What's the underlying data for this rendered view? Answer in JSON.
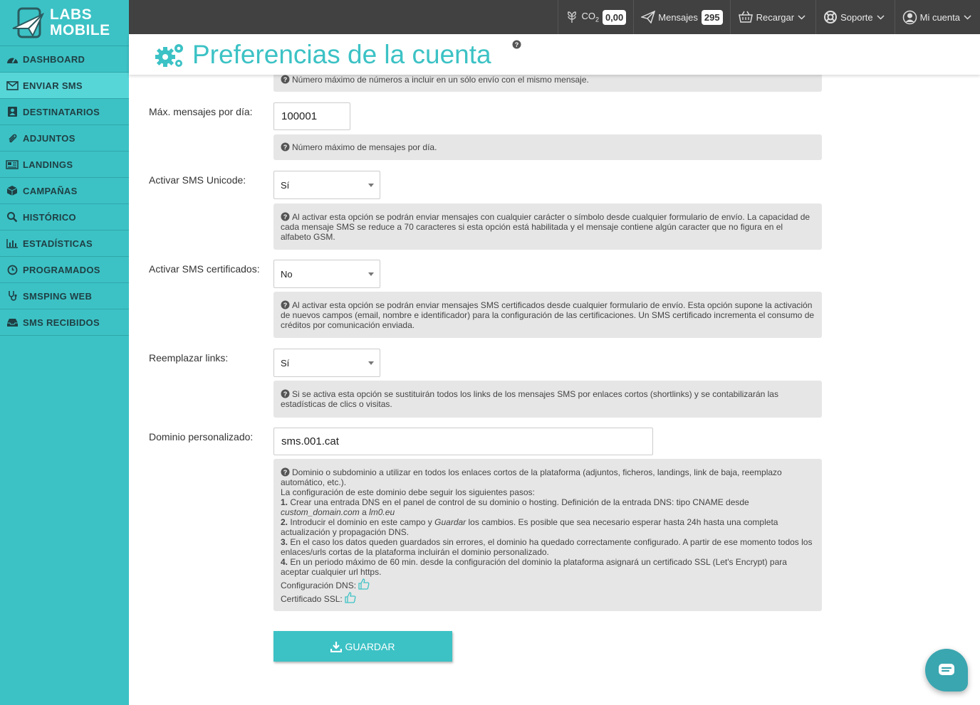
{
  "brand": {
    "line1": "LABS",
    "line2": "MOBILE"
  },
  "sidebar": {
    "items": [
      {
        "label": "DASHBOARD",
        "icon": "dashboard-icon"
      },
      {
        "label": "ENVIAR SMS",
        "icon": "envelope-icon",
        "active": true
      },
      {
        "label": "DESTINATARIOS",
        "icon": "contacts-icon"
      },
      {
        "label": "ADJUNTOS",
        "icon": "paperclip-icon"
      },
      {
        "label": "LANDINGS",
        "icon": "newspaper-icon"
      },
      {
        "label": "CAMPAÑAS",
        "icon": "cube-icon"
      },
      {
        "label": "HISTÓRICO",
        "icon": "search-icon"
      },
      {
        "label": "ESTADÍSTICAS",
        "icon": "bar-chart-icon"
      },
      {
        "label": "PROGRAMADOS",
        "icon": "clock-icon"
      },
      {
        "label": "SMSPING WEB",
        "icon": "stethoscope-icon"
      },
      {
        "label": "SMS RECIBIDOS",
        "icon": "inbox-icon"
      }
    ]
  },
  "topbar": {
    "co2_label": "CO",
    "co2_sub": "2",
    "co2_value": "0,00",
    "messages_label": "Mensajes",
    "messages_value": "295",
    "recharge_label": "Recargar",
    "support_label": "Soporte",
    "account_label": "Mi cuenta"
  },
  "page": {
    "title": "Preferencias de la cuenta"
  },
  "form": {
    "top_help": "Número máximo de números a incluir en un sólo envío con el mismo mensaje.",
    "max_per_day": {
      "label": "Máx. mensajes por día:",
      "value": "100001",
      "help": "Número máximo de mensajes por día."
    },
    "unicode": {
      "label": "Activar SMS Unicode:",
      "value": "Sí",
      "help": "Al activar esta opción se podrán enviar mensajes con cualquier carácter o símbolo desde cualquier formulario de envío. La capacidad de cada mensaje SMS se reduce a 70 caracteres si esta opción está habilitada y el mensaje contiene algún caracter que no figura en el alfabeto GSM."
    },
    "certified": {
      "label": "Activar SMS certificados:",
      "value": "No",
      "help": "Al activar esta opción se podrán enviar mensajes SMS certificados desde cualquier formulario de envío. Esta opción supone la activación de nuevos campos (email, nombre e identificador) para la configuración de las certificaciones. Un SMS certificado incrementa el consumo de créditos por comunicación enviada."
    },
    "links": {
      "label": "Reemplazar links:",
      "value": "Sí",
      "help": "Si se activa esta opción se sustituirán todos los links de los mensajes SMS por enlaces cortos (shortlinks) y se contabilizarán las estadísticas de clics o visitas."
    },
    "domain": {
      "label": "Dominio personalizado:",
      "value": "sms.001.cat",
      "help_intro": "Dominio o subdominio a utilizar en todos los enlaces cortos de la plataforma (adjuntos, ficheros, landings, link de baja, reemplazo automático, etc.).",
      "help_steps_title": "La configuración de este dominio debe seguir los siguientes pasos:",
      "step1_num": "1.",
      "step1_text": "Crear una entrada DNS en el panel de control de su dominio o hosting. Definición de la entrada DNS: tipo CNAME desde",
      "step1_from": "custom_domain.com",
      "step1_a": "a",
      "step1_to": "lm0.eu",
      "step2_num": "2.",
      "step2_a": "Introducir el dominio en este campo y",
      "step2_em": "Guardar",
      "step2_b": "los cambios. Es posible que sea necesario esperar hasta 24h hasta una completa actualización y propagación DNS.",
      "step3_num": "3.",
      "step3_text": "En el caso los datos queden guardados sin errores, el dominio ha quedado correctamente configurado. A partir de ese momento todos los enlaces/urls cortas de la plataforma incluirán el dominio personalizado.",
      "step4_num": "4.",
      "step4_text": "En un periodo máximo de 60 min. desde la configuración del dominio la plataforma asignará un certificado SSL (Let's Encrypt) para aceptar cualquier url https.",
      "dns_label": "Configuración DNS:",
      "ssl_label": "Certificado SSL:"
    },
    "save_label": "GUARDAR"
  }
}
